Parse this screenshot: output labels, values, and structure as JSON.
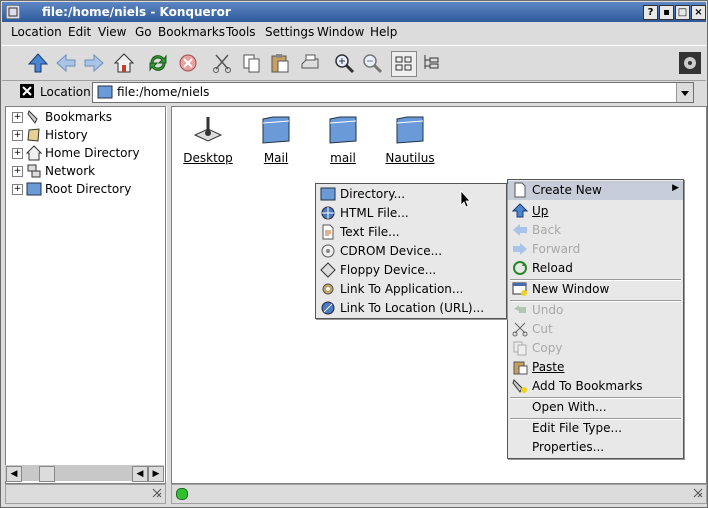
{
  "window": {
    "title": "file:/home/niels - Konqueror",
    "buttons": [
      "?",
      "▪",
      "□",
      "×"
    ]
  },
  "menubar": [
    "Location",
    "Edit",
    "View",
    "Go",
    "Bookmarks",
    "Tools",
    "Settings",
    "Window",
    "Help"
  ],
  "location": {
    "label": "Location",
    "value": "file:/home/niels"
  },
  "tree": [
    "Bookmarks",
    "History",
    "Home Directory",
    "Network",
    "Root Directory"
  ],
  "files": [
    "Desktop",
    "Mail",
    "mail",
    "Nautilus"
  ],
  "context_menu": {
    "create_new": "Create New",
    "up": "Up",
    "back": "Back",
    "forward": "Forward",
    "reload": "Reload",
    "new_window": "New Window",
    "undo": "Undo",
    "cut": "Cut",
    "copy": "Copy",
    "paste": "Paste",
    "add_bookmarks": "Add To Bookmarks",
    "open_with": "Open With...",
    "edit_file_type": "Edit File Type...",
    "properties": "Properties..."
  },
  "create_new_submenu": [
    "Directory...",
    "HTML File...",
    "Text File...",
    "CDROM Device...",
    "Floppy Device...",
    "Link To Application...",
    "Link To Location (URL)..."
  ],
  "colors": {
    "title_bar": "#2f5a9a",
    "folder": "#6a9bd8",
    "menu_bg": "#e8e8e8"
  }
}
